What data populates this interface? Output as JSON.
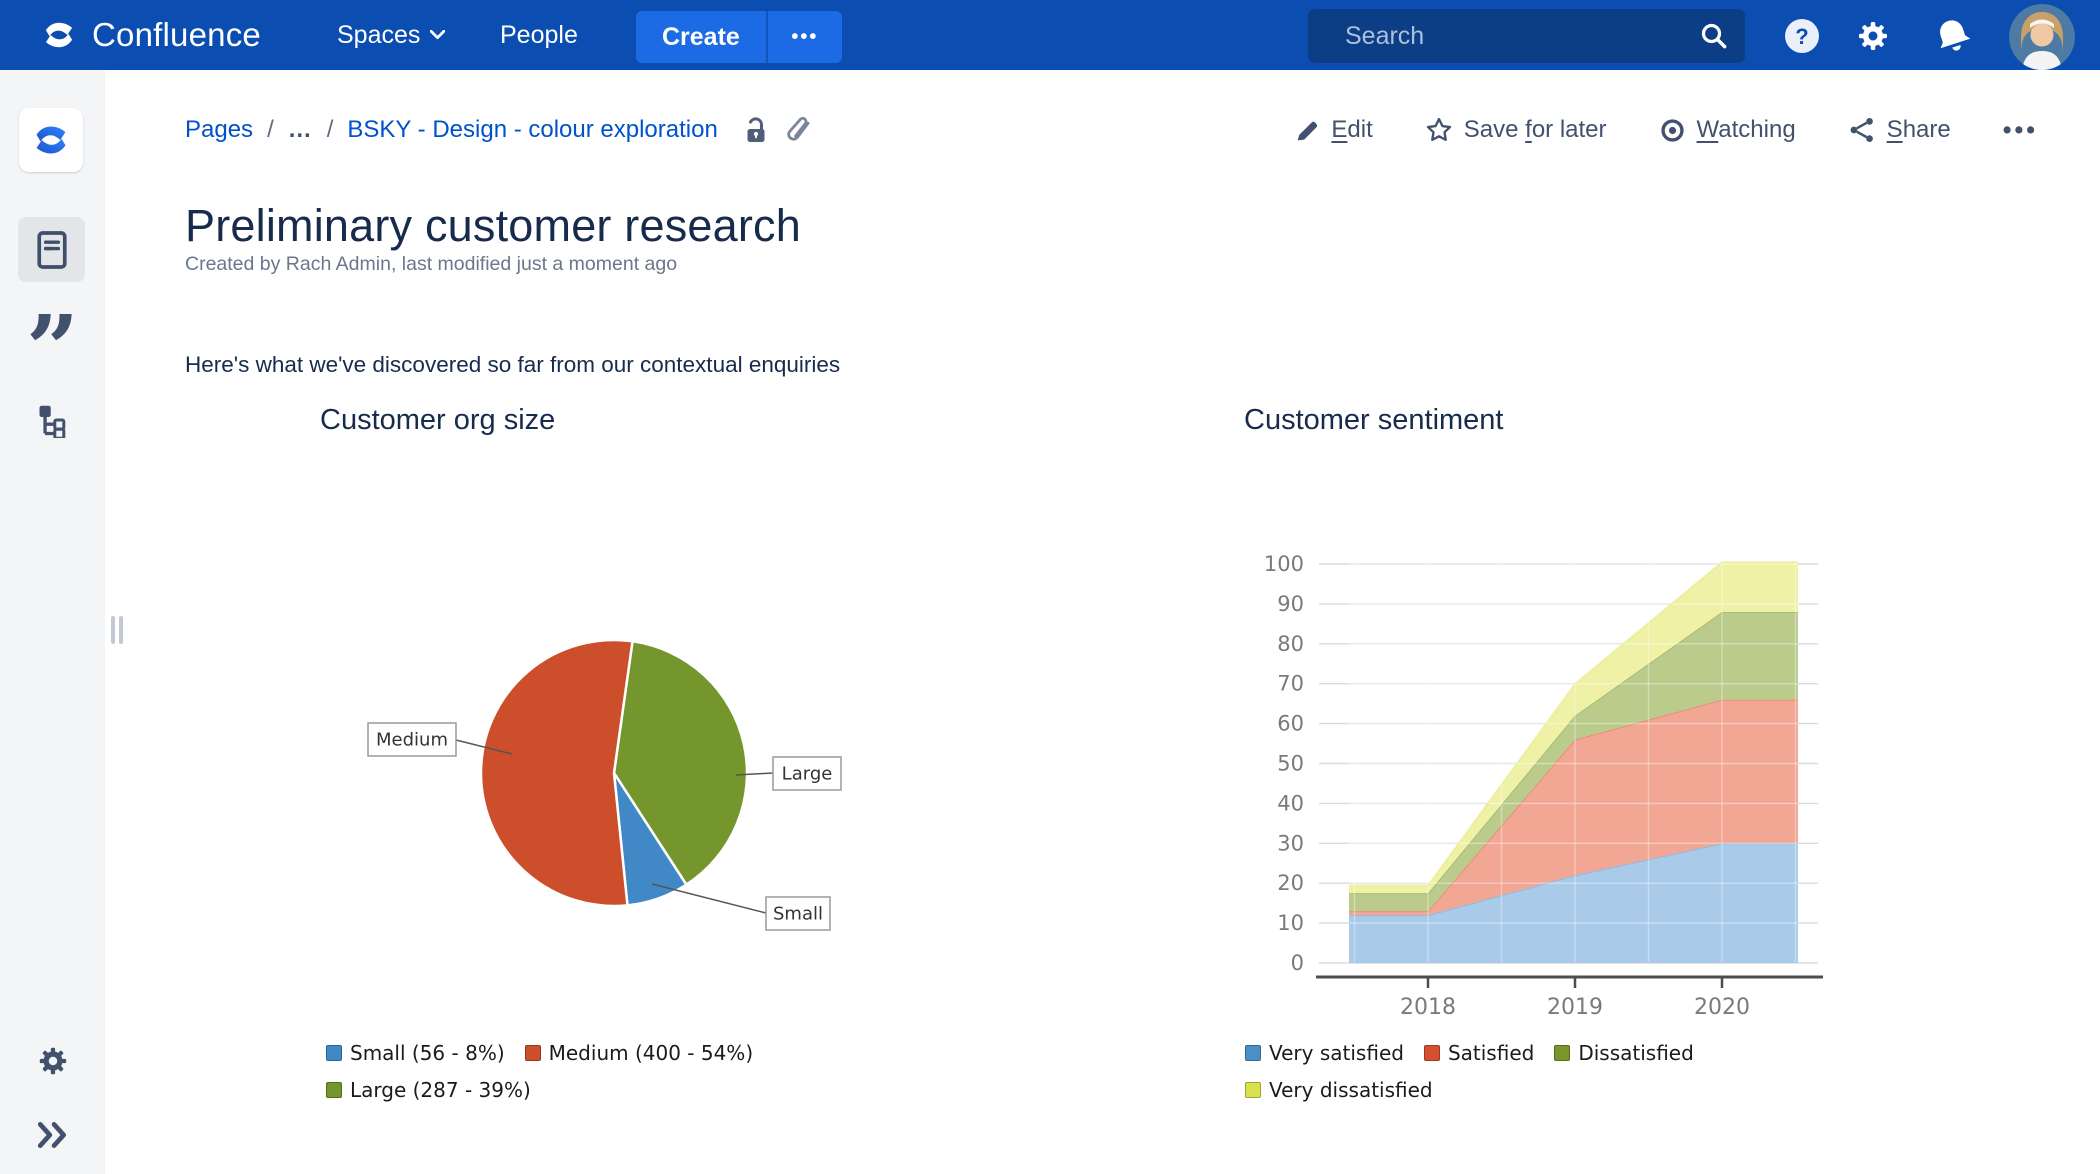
{
  "topnav": {
    "brand": "Confluence",
    "spaces_label": "Spaces",
    "people_label": "People",
    "create_label": "Create",
    "more_label": "•••",
    "search_placeholder": "Search",
    "colors": {
      "bar_bg": "#0C4DB2",
      "create_bg": "#1C6AE4",
      "search_bg": "#0C3E86"
    }
  },
  "breadcrumb": {
    "root": "Pages",
    "separator": "/",
    "ellipsis": "…",
    "current": "BSKY - Design - colour exploration"
  },
  "actions": {
    "edit_key": "E",
    "edit_rest": "dit",
    "save_pre": "Save ",
    "save_key": "f",
    "save_rest": "or later",
    "watch_key": "W",
    "watch_rest": "atching",
    "share_key": "S",
    "share_rest": "hare",
    "more": "•••"
  },
  "page": {
    "title": "Preliminary customer research",
    "byline": "Created by Rach Admin, last modified just a moment ago",
    "intro": "Here's what we've discovered so far from our contextual enquiries"
  },
  "icons": {
    "help_glyph": "?"
  },
  "chart_data": [
    {
      "type": "pie",
      "title": "Customer org size",
      "categories": [
        "Small",
        "Medium",
        "Large"
      ],
      "values": [
        56,
        400,
        287
      ],
      "percents": [
        8,
        54,
        39
      ],
      "colors": [
        "#4189C6",
        "#CC4E2B",
        "#75952D"
      ],
      "legend": [
        "Small (56 - 8%)",
        "Medium (400 - 54%)",
        "Large (287 - 39%)"
      ],
      "legend_position": "bottom",
      "rotation_deg": 8,
      "draw_order": [
        "Large",
        "Small",
        "Medium"
      ]
    },
    {
      "type": "area",
      "title": "Customer sentiment",
      "stacked": true,
      "x": [
        2018,
        2019,
        2020
      ],
      "series": [
        {
          "name": "Very satisfied",
          "color": "#4A90C4",
          "fill": "#A9CAE8",
          "values": [
            12,
            22,
            30
          ]
        },
        {
          "name": "Satisfied",
          "color": "#D4502E",
          "fill": "#F2A795",
          "values": [
            1,
            34,
            36
          ]
        },
        {
          "name": "Dissatisfied",
          "color": "#7A962A",
          "fill": "#BACB8C",
          "values": [
            4.5,
            6,
            22
          ]
        },
        {
          "name": "Very dissatisfied",
          "color": "#DBE14D",
          "fill": "#EFF2A6",
          "values": [
            2,
            8,
            12.5
          ]
        }
      ],
      "ylim": [
        0,
        100
      ],
      "ytick": 10,
      "grid": true,
      "legend_position": "bottom"
    }
  ]
}
